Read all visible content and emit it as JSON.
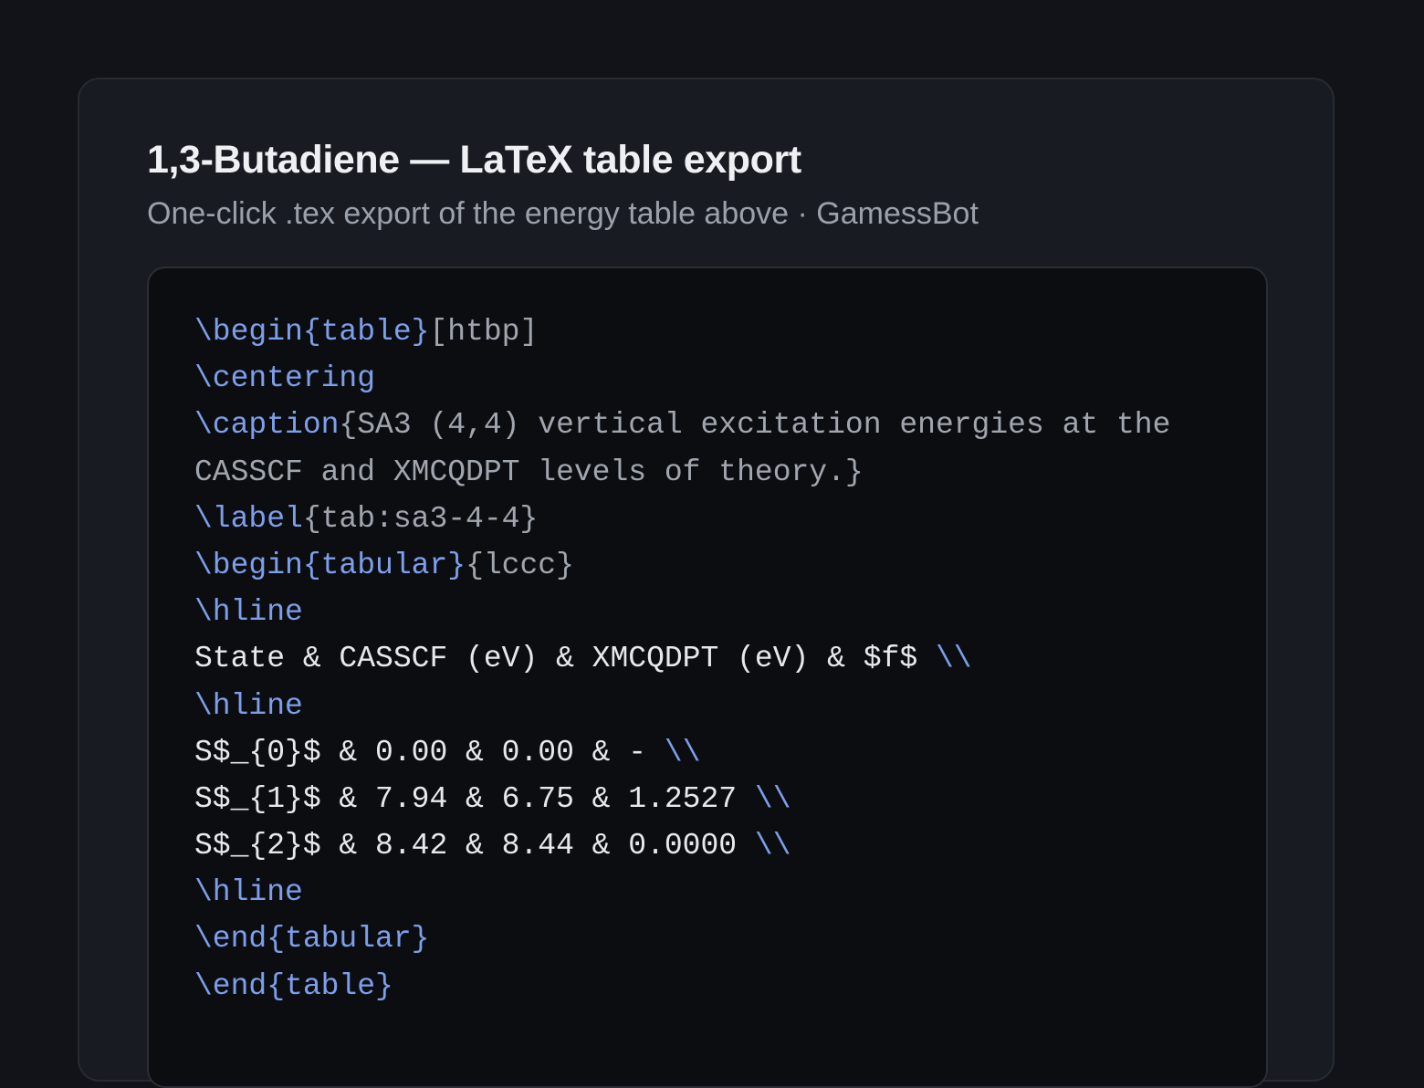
{
  "card": {
    "title": "1,3-Butadiene — LaTeX table export",
    "subtitle": "One-click .tex export of the energy table above · GamessBot"
  },
  "code": {
    "line1": {
      "cmd": "\\begin{table}",
      "arg": "[htbp]"
    },
    "line2": {
      "cmd": "\\centering"
    },
    "line3": {
      "cmd": "\\caption",
      "arg_a": "{SA3 (4,4) vertical excitation energies at the",
      "arg_b": "CASSCF and XMCQDPT levels of theory.}"
    },
    "line4": {
      "cmd": "\\label",
      "arg": "{tab:sa3-4-4}"
    },
    "line5": {
      "cmd": "\\begin{tabular}",
      "arg": "{lccc}"
    },
    "line6": {
      "cmd": "\\hline"
    },
    "line7": {
      "text": "State & CASSCF (eV) & XMCQDPT (eV) & $f$ ",
      "end": "\\\\"
    },
    "line8": {
      "cmd": "\\hline"
    },
    "line9": {
      "text": "S$_{0}$ & 0.00 & 0.00 & - ",
      "end": "\\\\"
    },
    "line10": {
      "text": "S$_{1}$ & 7.94 & 6.75 & 1.2527 ",
      "end": "\\\\"
    },
    "line11": {
      "text": "S$_{2}$ & 8.42 & 8.44 & 0.0000 ",
      "end": "\\\\"
    },
    "line12": {
      "cmd": "\\hline"
    },
    "line13": {
      "cmd": "\\end{tabular}"
    },
    "line14": {
      "cmd": "\\end{table}"
    }
  },
  "colors": {
    "background": "#111318",
    "card": "#181b21",
    "code_background": "#0c0d11",
    "latex_command": "#7d9fea",
    "latex_argument": "#a0a6af",
    "plain_text": "#e6e8eb"
  }
}
